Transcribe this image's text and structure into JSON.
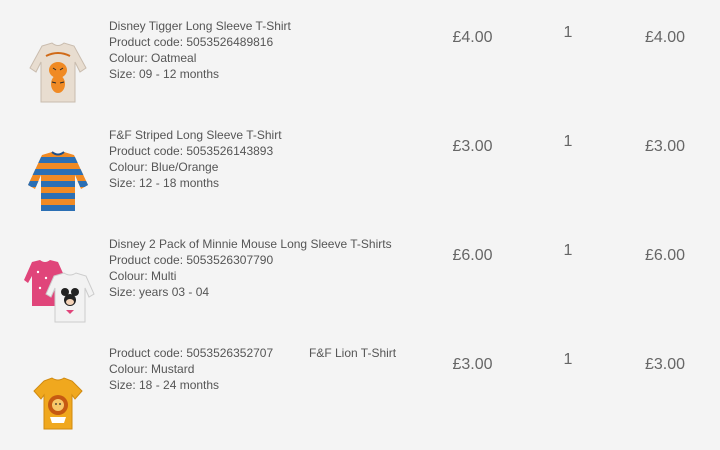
{
  "items": [
    {
      "name": "Disney Tigger Long Sleeve T-Shirt",
      "product_code": "Product code: 5053526489816",
      "colour": "Colour: Oatmeal",
      "size": "Size: 09 - 12 months",
      "price": "£4.00",
      "quantity": "1",
      "total": "£4.00",
      "image_icon": "tigger-shirt-thumbnail",
      "image_color": "#e8ddd0"
    },
    {
      "name": "F&F Striped Long Sleeve T-Shirt",
      "product_code": "Product code: 5053526143893",
      "colour": "Colour: Blue/Orange",
      "size": "Size: 12 - 18 months",
      "price": "£3.00",
      "quantity": "1",
      "total": "£3.00",
      "image_icon": "striped-shirt-thumbnail",
      "image_color": "#2b6fb4"
    },
    {
      "name": "Disney 2 Pack of Minnie Mouse Long Sleeve T-Shirts",
      "product_code": "Product code: 5053526307790",
      "colour": "Colour: Multi",
      "size": "Size: years 03 - 04",
      "price": "£6.00",
      "quantity": "1",
      "total": "£6.00",
      "image_icon": "minnie-shirts-thumbnail",
      "image_color": "#e0457a"
    },
    {
      "name": "F&F Lion T-Shirt",
      "product_code": "Product code: 5053526352707",
      "colour": "Colour: Mustard",
      "size": "Size: 18 - 24 months",
      "price": "£3.00",
      "quantity": "1",
      "total": "£3.00",
      "image_icon": "lion-shirt-thumbnail",
      "image_color": "#f0a81e"
    }
  ]
}
